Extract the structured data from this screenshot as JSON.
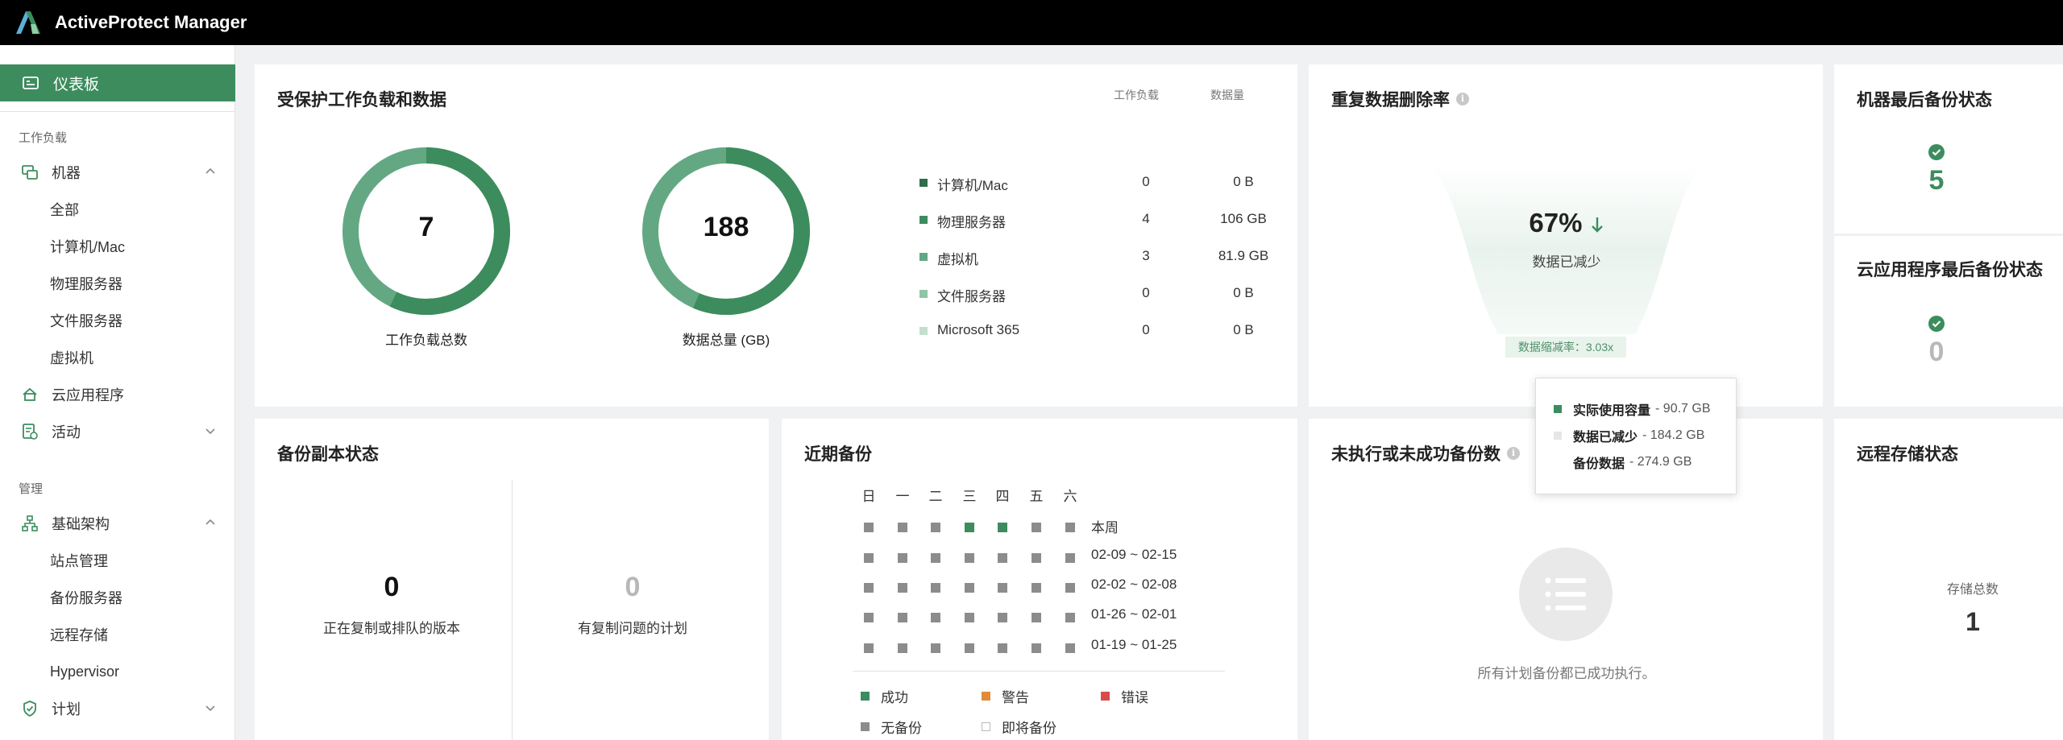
{
  "app": {
    "title": "ActiveProtect Manager"
  },
  "sidebar": {
    "dashboard": "仪表板",
    "section_workload": "工作负载",
    "machines": "机器",
    "machines_sub": [
      "全部",
      "计算机/Mac",
      "物理服务器",
      "文件服务器",
      "虚拟机"
    ],
    "cloud_apps": "云应用程序",
    "activities": "活动",
    "section_manage": "管理",
    "infrastructure": "基础架构",
    "infra_sub": [
      "站点管理",
      "备份服务器",
      "远程存储",
      "Hypervisor"
    ],
    "plans": "计划"
  },
  "protected": {
    "title": "受保护工作负载和数据",
    "total_workloads": "7",
    "total_workloads_label": "工作负载总数",
    "total_data": "188",
    "total_data_label": "数据总量 (GB)",
    "col_workloads": "工作负载",
    "col_data": "数据量",
    "rows": [
      {
        "name": "计算机/Mac",
        "count": "0",
        "data": "0 B",
        "color": "#2f6e49"
      },
      {
        "name": "物理服务器",
        "count": "4",
        "data": "106 GB",
        "color": "#3d8c5e"
      },
      {
        "name": "虚拟机",
        "count": "3",
        "data": "81.9 GB",
        "color": "#63a883"
      },
      {
        "name": "文件服务器",
        "count": "0",
        "data": "0 B",
        "color": "#8fc4a6"
      },
      {
        "name": "Microsoft 365",
        "count": "0",
        "data": "0 B",
        "color": "#c3dfcf"
      }
    ]
  },
  "dedup": {
    "title": "重复数据删除率",
    "percent": "67%",
    "sub": "数据已减少",
    "ratio_badge": "数据缩减率：3.03x",
    "tooltip": {
      "used_label": "实际使用容量",
      "used_value": "- 90.7 GB",
      "reduced_label": "数据已减少",
      "reduced_value": "- 184.2 GB",
      "backup_label": "备份数据",
      "backup_value": "- 274.9 GB"
    }
  },
  "machine_last_backup": {
    "title": "机器最后备份状态",
    "count": "5"
  },
  "cloud_last_backup": {
    "title": "云应用程序最后备份状态",
    "count": "0"
  },
  "replica": {
    "title": "备份副本状态",
    "replicating_count": "0",
    "replicating_label": "正在复制或排队的版本",
    "issue_count": "0",
    "issue_label": "有复制问题的计划"
  },
  "recent": {
    "title": "近期备份",
    "days": [
      "日",
      "一",
      "二",
      "三",
      "四",
      "五",
      "六"
    ],
    "weeks": [
      {
        "label": "本周",
        "status": [
          "none",
          "none",
          "none",
          "success",
          "success",
          "none",
          "none"
        ]
      },
      {
        "label": "02-09 ~ 02-15",
        "status": [
          "none",
          "none",
          "none",
          "none",
          "none",
          "none",
          "none"
        ]
      },
      {
        "label": "02-02 ~ 02-08",
        "status": [
          "none",
          "none",
          "none",
          "none",
          "none",
          "none",
          "none"
        ]
      },
      {
        "label": "01-26 ~ 02-01",
        "status": [
          "none",
          "none",
          "none",
          "none",
          "none",
          "none",
          "none"
        ]
      },
      {
        "label": "01-19 ~ 01-25",
        "status": [
          "none",
          "none",
          "none",
          "none",
          "none",
          "none",
          "none"
        ]
      }
    ],
    "legend": {
      "success": "成功",
      "warning": "警告",
      "error": "错误",
      "none": "无备份",
      "upcoming": "即将备份"
    }
  },
  "failed": {
    "title": "未执行或未成功备份数",
    "empty_text": "所有计划备份都已成功执行。"
  },
  "remote": {
    "title": "远程存储状态",
    "total_label": "存储总数",
    "total": "1"
  }
}
